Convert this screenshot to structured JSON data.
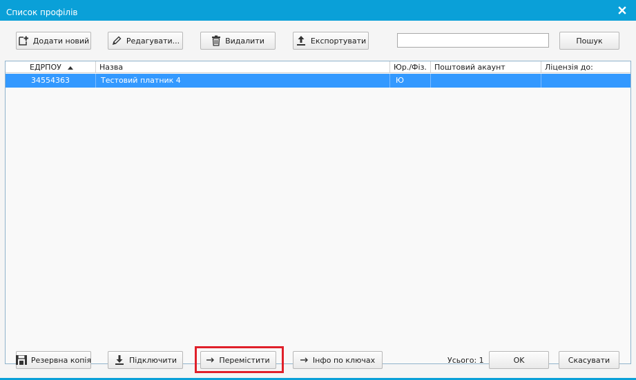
{
  "window": {
    "title": "Список профілів",
    "accent_color": "#0aa0d8",
    "close_icon": "close-icon"
  },
  "toolbar": {
    "add_label": "Додати новий",
    "edit_label": "Редагувати...",
    "delete_label": "Видалити",
    "export_label": "Експортувати",
    "search_value": "",
    "search_label": "Пошук"
  },
  "grid": {
    "columns": [
      "ЕДРПОУ",
      "Назва",
      "Юр./Фіз.",
      "Поштовий акаунт",
      "Ліцензія до:"
    ],
    "sort_column": "ЕДРПОУ",
    "sort_direction": "ascending",
    "selection_color": "#3399ff",
    "rows": [
      [
        "34554363",
        "Тестовий платник 4",
        "Ю",
        "",
        ""
      ]
    ]
  },
  "footer": {
    "backup_label": "Резервна копія",
    "connect_label": "Підключити",
    "move_label": "Перемістити",
    "keys_info_label": "Інфо по ключах",
    "total_text": "Усього: 1",
    "ok_label": "OK",
    "cancel_label": "Скасувати",
    "highlight_color": "#e0202a"
  }
}
